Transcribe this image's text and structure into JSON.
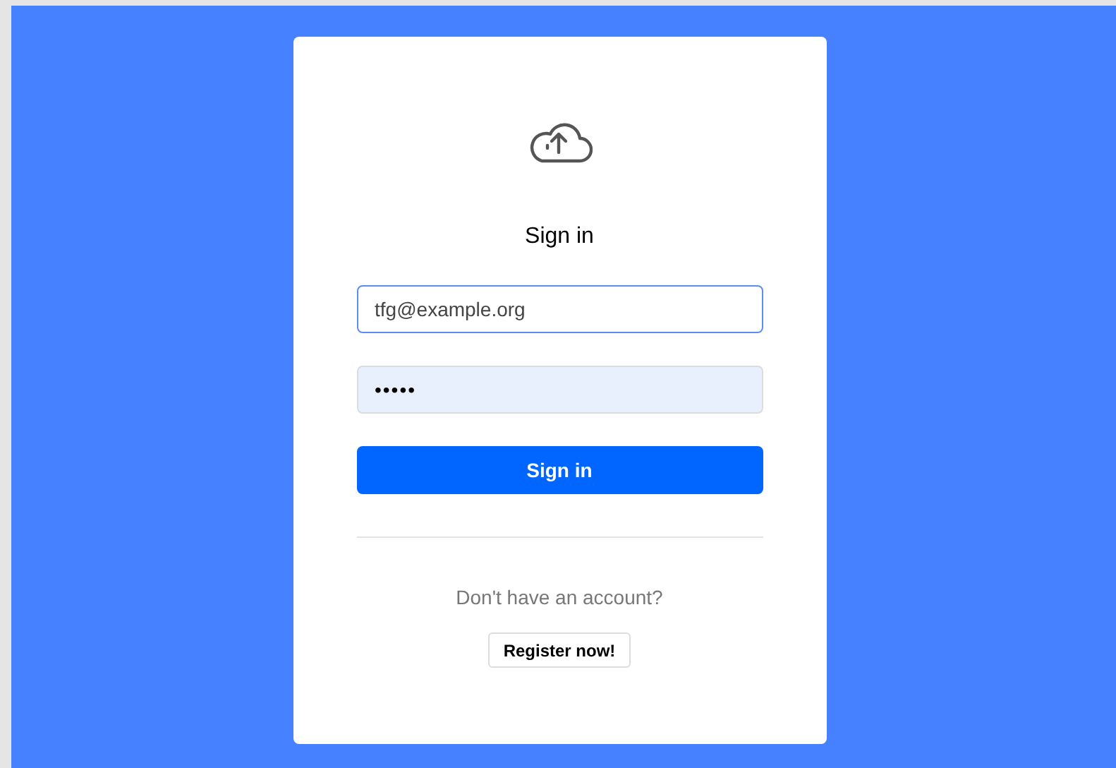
{
  "title": "Sign in",
  "fields": [
    {
      "kind": "email",
      "value": "tfg@example.org",
      "focused": true,
      "autofilled": false
    },
    {
      "kind": "password",
      "value": "•••••",
      "focused": false,
      "autofilled": true
    }
  ],
  "submit": "Sign in",
  "register_prompt": "Don't have an account?",
  "register_button": "Register now!"
}
